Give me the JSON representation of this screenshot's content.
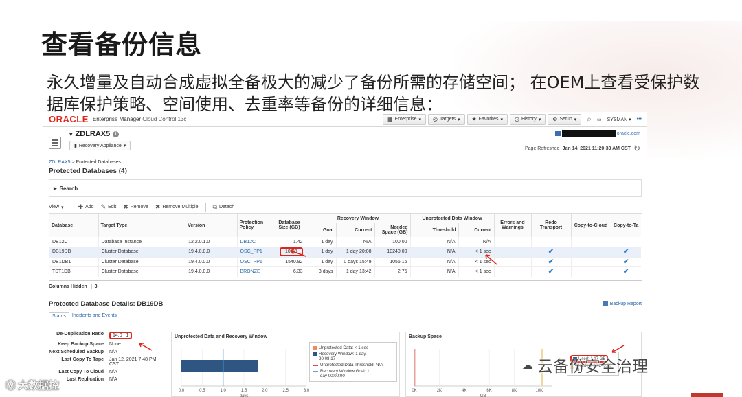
{
  "slide": {
    "title": "查看备份信息",
    "description": "永久增量及自动合成虚拟全备极大的减少了备份所需的存储空间； 在OEM上查看受保护数据库保护策略、空间使用、去重率等备份的详细信息："
  },
  "em": {
    "logo": "ORACLE",
    "product_title": "Enterprise Manager",
    "product_subtitle": "Cloud Control 13c",
    "nav": [
      {
        "label": "Enterprise",
        "icon": "building-icon"
      },
      {
        "label": "Targets",
        "icon": "target-icon"
      },
      {
        "label": "Favorites",
        "icon": "star-icon"
      },
      {
        "label": "History",
        "icon": "clock-icon"
      },
      {
        "label": "Setup",
        "icon": "gear-icon"
      }
    ],
    "user": "SYSMAN",
    "more": "•••",
    "target_name": "ZDLRAX5",
    "target_menu": "Recovery Appliance",
    "account_domain": "oracle.com",
    "refreshed_label": "Page Refreshed",
    "refreshed_time": "Jan 14, 2021 11:20:33 AM CST",
    "breadcrumb": [
      "ZDLRAX5",
      "Protected Databases"
    ],
    "page_title": "Protected Databases (4)",
    "search_label": "Search",
    "toolbar": {
      "view": "View",
      "add": "Add",
      "edit": "Edit",
      "remove": "Remove",
      "remove_multiple": "Remove Multiple",
      "detach": "Detach"
    },
    "table": {
      "group_recovery_window": "Recovery Window",
      "group_unprotected": "Unprotected Data Window",
      "headers": {
        "database": "Database",
        "target_type": "Target Type",
        "version": "Version",
        "policy": "Protection Policy",
        "size": "Database Size (GB)",
        "goal": "Goal",
        "current": "Current",
        "needed": "Needed Space (GB)",
        "threshold": "Threshold",
        "current2": "Current",
        "errors": "Errors and Warnings",
        "redo": "Redo Transport",
        "copy_cloud": "Copy-to-Cloud",
        "copy_tape": "Copy-to-Ta"
      },
      "rows": [
        {
          "database": "DB12C",
          "target_type": "Database Instance",
          "version": "12.2.0.1.0",
          "policy": "DB12C",
          "size": "1.42",
          "goal": "1 day",
          "current": "N/A",
          "needed": "100.00",
          "threshold": "N/A",
          "current2": "N/A",
          "redo": "",
          "tape": ""
        },
        {
          "database": "DB19DB",
          "target_type": "Cluster Database",
          "version": "19.4.0.0.0",
          "policy": "OSC_PP1",
          "size": "10.00",
          "goal": "1 day",
          "current": "1 day 20:08",
          "needed": "10240.00",
          "threshold": "N/A",
          "current2": "< 1 sec",
          "redo": "✔",
          "tape": "✔"
        },
        {
          "database": "DB1DB1",
          "target_type": "Cluster Database",
          "version": "19.4.0.0.0",
          "policy": "OSC_PP1",
          "size": "1540.92",
          "goal": "1 day",
          "current": "0 days 15:49",
          "needed": "1056.16",
          "threshold": "N/A",
          "current2": "< 1 sec",
          "redo": "✔",
          "tape": "✔"
        },
        {
          "database": "TST1DB",
          "target_type": "Cluster Database",
          "version": "19.4.0.0.0",
          "policy": "BRONZE",
          "size": "6.33",
          "goal": "3 days",
          "current": "1 day 13:42",
          "needed": "2.75",
          "threshold": "N/A",
          "current2": "< 1 sec",
          "redo": "✔",
          "tape": "✔"
        }
      ],
      "columns_hidden_label": "Columns Hidden",
      "columns_hidden_count": "3"
    },
    "details": {
      "title": "Protected Database Details: DB19DB",
      "backup_report": "Backup Report",
      "tabs": [
        "Status",
        "Incidents and Events"
      ],
      "fields": [
        {
          "label": "De-Duplication Ratio",
          "value": "14.0 : 1"
        },
        {
          "label": "Keep Backup Space",
          "value": "None"
        },
        {
          "label": "Next Scheduled Backup",
          "value": "N/A"
        },
        {
          "label": "Last Copy To Tape",
          "value": "Jan 12, 2021 7:48 PM CST"
        },
        {
          "label": "Last Copy To Cloud",
          "value": "N/A"
        },
        {
          "label": "Last Replication",
          "value": "N/A"
        }
      ]
    },
    "unprotected_chart": {
      "title": "Unprotected Data and Recovery Window",
      "xlabel": "days",
      "ticks": [
        "0.0",
        "0.5",
        "1.0",
        "1.5",
        "2.0",
        "2.5",
        "3.0"
      ],
      "legend": [
        {
          "label": "Unprotected Data: < 1 sec",
          "color": "#f08a5d",
          "kind": "box"
        },
        {
          "label": "Recovery Window: 1 day 20:08:17",
          "color": "#2f5583",
          "kind": "box"
        },
        {
          "label": "Unprotected Data Threshold: N/A",
          "color": "#e04a4a",
          "kind": "line"
        },
        {
          "label": "Recovery Window Goal: 1 day 00:00:00",
          "color": "#5aa6e0",
          "kind": "line"
        }
      ]
    },
    "space_chart": {
      "title": "Backup Space",
      "xlabel": "GB",
      "ticks": [
        "0K",
        "2K",
        "4K",
        "6K",
        "8K",
        "10K"
      ],
      "used_label": "Used: 1.17 GB",
      "needed_label": "Needed: 10,240.00 G"
    }
  },
  "chart_data": [
    {
      "type": "bar",
      "title": "Unprotected Data and Recovery Window",
      "xlabel": "days",
      "xlim": [
        0,
        3
      ],
      "series": [
        {
          "name": "Recovery Window: 1 day 20:08:17",
          "values": [
            1.84
          ]
        },
        {
          "name": "Recovery Window Goal: 1 day 00:00:00",
          "values": [
            1.0
          ]
        }
      ]
    },
    {
      "type": "bar",
      "title": "Backup Space",
      "xlabel": "GB",
      "xlim": [
        0,
        11000
      ],
      "series": [
        {
          "name": "Used: 1.17 GB",
          "values": [
            1.17
          ]
        },
        {
          "name": "Needed: 10,240.00 G",
          "values": [
            10240
          ]
        }
      ]
    }
  ],
  "watermarks": {
    "left": "大数据控",
    "right": "云备份安全治理"
  }
}
